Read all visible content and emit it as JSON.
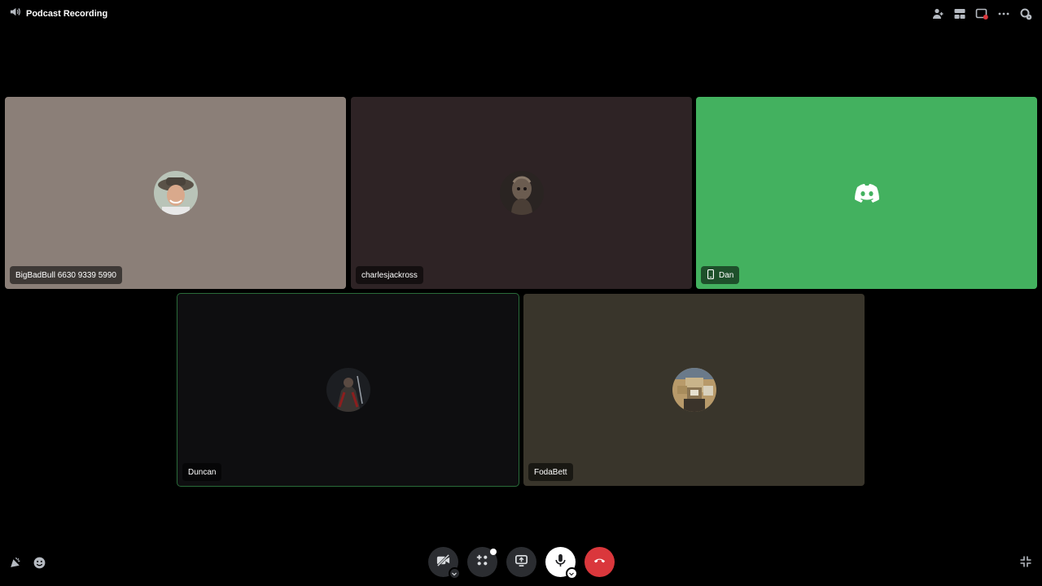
{
  "header": {
    "channel_icon": "speaker-icon",
    "channel_name": "Podcast Recording",
    "actions": [
      {
        "name": "invite-icon"
      },
      {
        "name": "layout-icon"
      },
      {
        "name": "popout-icon"
      },
      {
        "name": "more-options-icon"
      },
      {
        "name": "settings-icon"
      }
    ]
  },
  "participants": [
    {
      "name": "BigBadBull 6630 9339 5990",
      "background": "#8b7f78",
      "speaking": false,
      "mobile": false
    },
    {
      "name": "charlesjackross",
      "background": "#2e2325",
      "speaking": false,
      "mobile": false
    },
    {
      "name": "Dan",
      "background": "#43b15f",
      "speaking": false,
      "mobile": true
    },
    {
      "name": "Duncan",
      "background": "#0e0e10",
      "speaking": true,
      "mobile": false
    },
    {
      "name": "FodaBett",
      "background": "#39352b",
      "speaking": false,
      "mobile": false
    }
  ],
  "controls": [
    {
      "name": "camera-off-icon"
    },
    {
      "name": "activities-icon"
    },
    {
      "name": "screen-share-icon"
    },
    {
      "name": "microphone-icon"
    },
    {
      "name": "leave-call-icon"
    }
  ],
  "bottom_left": [
    {
      "name": "soundboard-icon"
    },
    {
      "name": "emoji-icon"
    }
  ],
  "bottom_right": {
    "name": "collapse-icon"
  },
  "colors": {
    "leave": "#da373c",
    "speaking_outline": "#2a6b3a",
    "discord_green": "#43b15f"
  }
}
